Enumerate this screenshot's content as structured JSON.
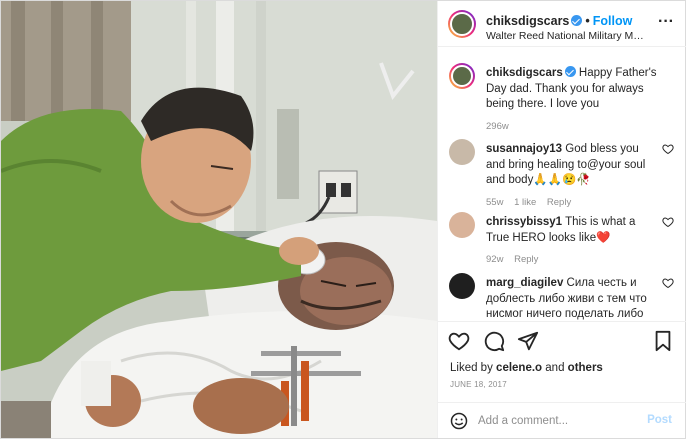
{
  "header": {
    "username": "chiksdigscars",
    "follow_label": "Follow",
    "location": "Walter Reed National Military Medical ..."
  },
  "caption": {
    "username": "chiksdigscars",
    "text": "Happy Father's Day dad. Thank you for always being there. I love you",
    "time": "296w"
  },
  "comments": [
    {
      "username": "susannajoy13",
      "text": "God bless you and bring healing to@your soul and body🙏🙏😢🥀",
      "time": "55w",
      "likes": "1 like",
      "reply": "Reply"
    },
    {
      "username": "chrissybissy1",
      "text": "This is what a True HERO looks like❤️",
      "time": "92w",
      "reply": "Reply"
    },
    {
      "username": "marg_diagilev",
      "text": "Сила честь и доблесть либо живи с тем что нисмог ничего поделать либо"
    }
  ],
  "likes": {
    "prefix": "Liked by",
    "user": "celene.o",
    "and": "and",
    "others": "others"
  },
  "date": "JUNE 18, 2017",
  "add_comment": {
    "placeholder": "Add a comment...",
    "post_label": "Post"
  },
  "icons": {
    "more": "more-options-icon",
    "like": "heart-icon",
    "comment": "comment-icon",
    "share": "share-icon",
    "save": "bookmark-icon",
    "emoji": "emoji-icon"
  },
  "colors": {
    "accent": "#0095f6",
    "verified": "#3897f0",
    "secondary_text": "#8e8e8e",
    "post_disabled": "#b3dbff"
  }
}
